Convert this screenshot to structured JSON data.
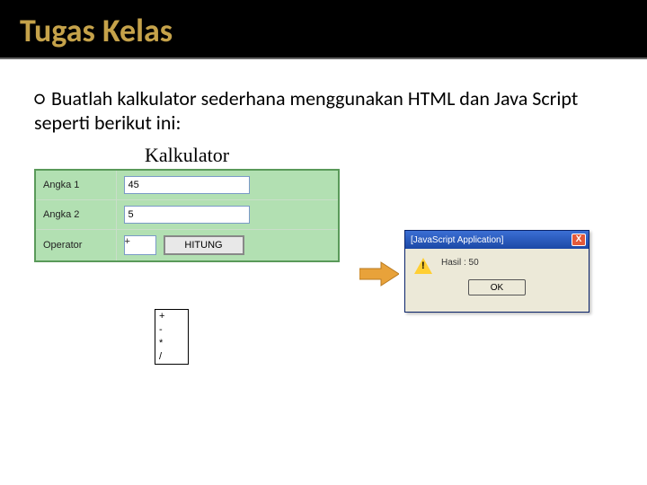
{
  "slide": {
    "title": "Tugas Kelas",
    "bullet_symbol": "○",
    "instruction": "Buatlah kalkulator sederhana menggunakan HTML dan Java Script seperti berikut ini:"
  },
  "calculator": {
    "heading": "Kalkulator",
    "rows": {
      "angka1": {
        "label": "Angka 1",
        "value": "45"
      },
      "angka2": {
        "label": "Angka 2",
        "value": "5"
      },
      "operator": {
        "label": "Operator",
        "selected": "+"
      }
    },
    "operator_options": [
      "+",
      "-",
      "*",
      "/"
    ],
    "button_label": "HITUNG"
  },
  "dialog": {
    "title": "[JavaScript Application]",
    "close_symbol": "X",
    "message": "Hasil : 50",
    "ok_label": "OK"
  }
}
